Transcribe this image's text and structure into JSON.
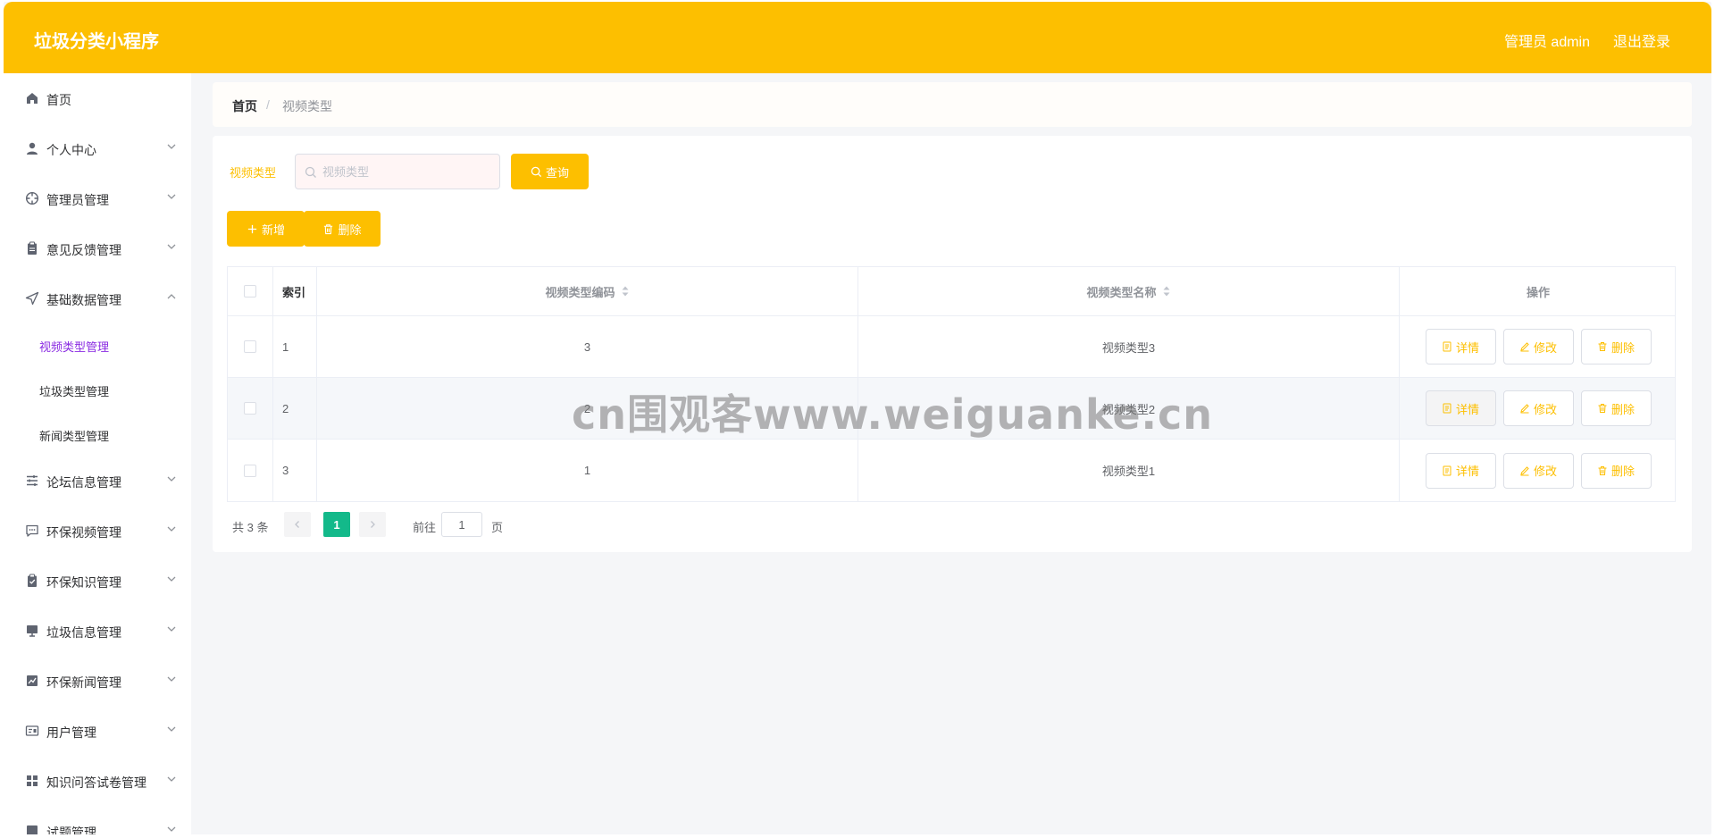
{
  "header": {
    "app_title": "垃圾分类小程序",
    "admin_label": "管理员 admin",
    "logout_label": "退出登录",
    "brand_color": "#fdbf00"
  },
  "sidebar": {
    "items": [
      {
        "label": "首页",
        "icon": "home-icon",
        "expandable": false
      },
      {
        "label": "个人中心",
        "icon": "user-icon",
        "expandable": true
      },
      {
        "label": "管理员管理",
        "icon": "crosshair-icon",
        "expandable": true
      },
      {
        "label": "意见反馈管理",
        "icon": "clipboard-icon",
        "expandable": true
      },
      {
        "label": "基础数据管理",
        "icon": "send-icon",
        "expandable": true,
        "expanded": true,
        "children": [
          {
            "label": "视频类型管理",
            "active": true
          },
          {
            "label": "垃圾类型管理",
            "active": false
          },
          {
            "label": "新闻类型管理",
            "active": false
          }
        ]
      },
      {
        "label": "论坛信息管理",
        "icon": "list-icon",
        "expandable": true
      },
      {
        "label": "环保视频管理",
        "icon": "chat-icon",
        "expandable": true
      },
      {
        "label": "环保知识管理",
        "icon": "checklist-icon",
        "expandable": true
      },
      {
        "label": "垃圾信息管理",
        "icon": "monitor-icon",
        "expandable": true
      },
      {
        "label": "环保新闻管理",
        "icon": "chart-icon",
        "expandable": true
      },
      {
        "label": "用户管理",
        "icon": "id-card-icon",
        "expandable": true
      },
      {
        "label": "知识问答试卷管理",
        "icon": "grid-icon",
        "expandable": true
      },
      {
        "label": "试题管理",
        "icon": "doc-icon",
        "expandable": true
      }
    ]
  },
  "breadcrumb": {
    "home": "首页",
    "separator": "/",
    "current": "视频类型"
  },
  "search": {
    "label": "视频类型",
    "placeholder": "视频类型",
    "value": "",
    "query_label": "查询"
  },
  "toolbar": {
    "add_label": "新增",
    "delete_label": "删除"
  },
  "table": {
    "columns": {
      "index": "索引",
      "code": "视频类型编码",
      "name": "视频类型名称",
      "ops": "操作"
    },
    "rows": [
      {
        "index": "1",
        "code": "3",
        "name": "视频类型3"
      },
      {
        "index": "2",
        "code": "2",
        "name": "视频类型2"
      },
      {
        "index": "3",
        "code": "1",
        "name": "视频类型1"
      }
    ],
    "op_labels": {
      "detail": "详情",
      "edit": "修改",
      "delete": "删除"
    }
  },
  "pagination": {
    "total": "共 3 条",
    "current_page": "1",
    "goto_label": "前往",
    "goto_value": "1",
    "unit": "页",
    "active_color": "#13b98a"
  },
  "watermark": "cn围观客www.weiguanke.cn"
}
